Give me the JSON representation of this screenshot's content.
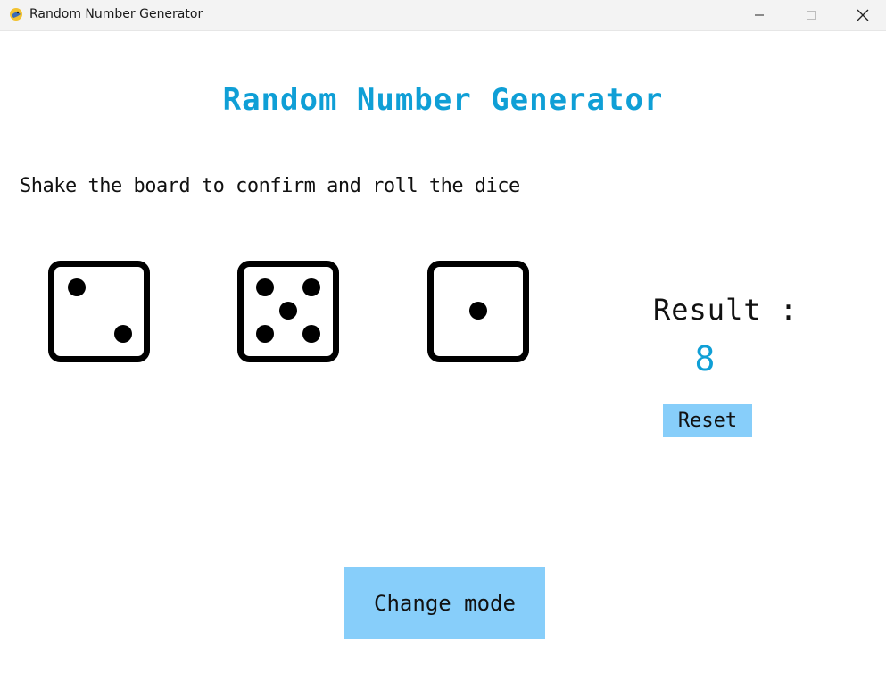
{
  "window": {
    "title": "Random Number Generator",
    "app_icon": "python-snake-icon"
  },
  "heading": "Random Number Generator",
  "instruction": "Shake the board to confirm and roll the dice",
  "dice": [
    {
      "face": 2,
      "icon": "die-face-2-icon"
    },
    {
      "face": 5,
      "icon": "die-face-5-icon"
    },
    {
      "face": 1,
      "icon": "die-face-1-icon"
    }
  ],
  "result": {
    "label": "Result :",
    "value": "8"
  },
  "buttons": {
    "reset_label": "Reset",
    "change_mode_label": "Change mode"
  },
  "colors": {
    "accent": "#0f9fd6",
    "button_bg": "#87cefa",
    "text": "#111111"
  }
}
